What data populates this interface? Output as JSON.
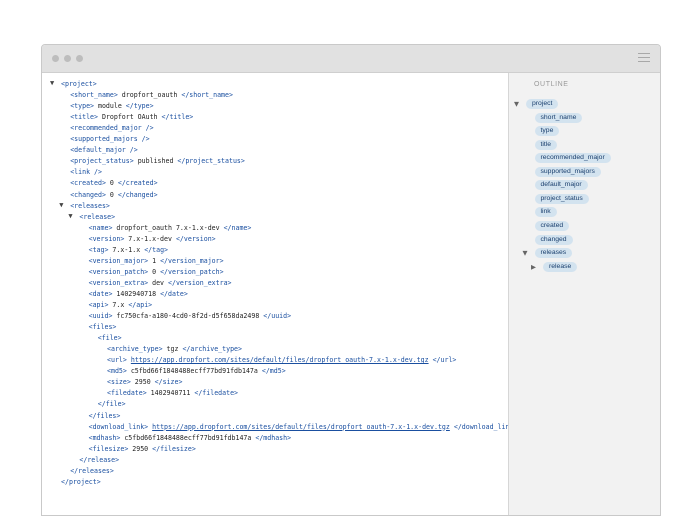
{
  "xml_lines": [
    {
      "indent": 0,
      "toggle": "▼",
      "parts": [
        {
          "t": "tag",
          "v": "<project>"
        }
      ]
    },
    {
      "indent": 1,
      "parts": [
        {
          "t": "tag",
          "v": "<short_name>"
        },
        {
          "t": "text",
          "v": " dropfort_oauth "
        },
        {
          "t": "tag",
          "v": "</short_name>"
        }
      ]
    },
    {
      "indent": 1,
      "parts": [
        {
          "t": "tag",
          "v": "<type>"
        },
        {
          "t": "text",
          "v": " module "
        },
        {
          "t": "tag",
          "v": "</type>"
        }
      ]
    },
    {
      "indent": 1,
      "parts": [
        {
          "t": "tag",
          "v": "<title>"
        },
        {
          "t": "text",
          "v": " Dropfort OAuth "
        },
        {
          "t": "tag",
          "v": "</title>"
        }
      ]
    },
    {
      "indent": 1,
      "parts": [
        {
          "t": "tag",
          "v": "<recommended_major />"
        }
      ]
    },
    {
      "indent": 1,
      "parts": [
        {
          "t": "tag",
          "v": "<supported_majors />"
        }
      ]
    },
    {
      "indent": 1,
      "parts": [
        {
          "t": "tag",
          "v": "<default_major />"
        }
      ]
    },
    {
      "indent": 1,
      "parts": [
        {
          "t": "tag",
          "v": "<project_status>"
        },
        {
          "t": "text",
          "v": " published "
        },
        {
          "t": "tag",
          "v": "</project_status>"
        }
      ]
    },
    {
      "indent": 1,
      "parts": [
        {
          "t": "tag",
          "v": "<link />"
        }
      ]
    },
    {
      "indent": 1,
      "parts": [
        {
          "t": "tag",
          "v": "<created>"
        },
        {
          "t": "text",
          "v": " 0 "
        },
        {
          "t": "tag",
          "v": "</created>"
        }
      ]
    },
    {
      "indent": 1,
      "parts": [
        {
          "t": "tag",
          "v": "<changed>"
        },
        {
          "t": "text",
          "v": " 0 "
        },
        {
          "t": "tag",
          "v": "</changed>"
        }
      ]
    },
    {
      "indent": 1,
      "toggle": "▼",
      "parts": [
        {
          "t": "tag",
          "v": "<releases>"
        }
      ]
    },
    {
      "indent": 2,
      "toggle": "▼",
      "parts": [
        {
          "t": "tag",
          "v": "<release>"
        }
      ]
    },
    {
      "indent": 3,
      "parts": [
        {
          "t": "tag",
          "v": "<name>"
        },
        {
          "t": "text",
          "v": " dropfort_oauth 7.x-1.x-dev "
        },
        {
          "t": "tag",
          "v": "</name>"
        }
      ]
    },
    {
      "indent": 3,
      "parts": [
        {
          "t": "tag",
          "v": "<version>"
        },
        {
          "t": "text",
          "v": " 7.x-1.x-dev "
        },
        {
          "t": "tag",
          "v": "</version>"
        }
      ]
    },
    {
      "indent": 3,
      "parts": [
        {
          "t": "tag",
          "v": "<tag>"
        },
        {
          "t": "text",
          "v": " 7.x-1.x "
        },
        {
          "t": "tag",
          "v": "</tag>"
        }
      ]
    },
    {
      "indent": 3,
      "parts": [
        {
          "t": "tag",
          "v": "<version_major>"
        },
        {
          "t": "text",
          "v": " 1 "
        },
        {
          "t": "tag",
          "v": "</version_major>"
        }
      ]
    },
    {
      "indent": 3,
      "parts": [
        {
          "t": "tag",
          "v": "<version_patch>"
        },
        {
          "t": "text",
          "v": " 0 "
        },
        {
          "t": "tag",
          "v": "</version_patch>"
        }
      ]
    },
    {
      "indent": 3,
      "parts": [
        {
          "t": "tag",
          "v": "<version_extra>"
        },
        {
          "t": "text",
          "v": " dev "
        },
        {
          "t": "tag",
          "v": "</version_extra>"
        }
      ]
    },
    {
      "indent": 3,
      "parts": [
        {
          "t": "tag",
          "v": "<date>"
        },
        {
          "t": "text",
          "v": " 1402940718 "
        },
        {
          "t": "tag",
          "v": "</date>"
        }
      ]
    },
    {
      "indent": 3,
      "parts": [
        {
          "t": "tag",
          "v": "<api>"
        },
        {
          "t": "text",
          "v": " 7.x "
        },
        {
          "t": "tag",
          "v": "</api>"
        }
      ]
    },
    {
      "indent": 3,
      "parts": [
        {
          "t": "tag",
          "v": "<uuid>"
        },
        {
          "t": "text",
          "v": " fc750cfa-a180-4cd0-8f2d-d5f658da2498 "
        },
        {
          "t": "tag",
          "v": "</uuid>"
        }
      ]
    },
    {
      "indent": 3,
      "parts": [
        {
          "t": "tag",
          "v": "<files>"
        }
      ]
    },
    {
      "indent": 4,
      "parts": [
        {
          "t": "tag",
          "v": "<file>"
        }
      ]
    },
    {
      "indent": 5,
      "parts": [
        {
          "t": "tag",
          "v": "<archive_type>"
        },
        {
          "t": "text",
          "v": " tgz "
        },
        {
          "t": "tag",
          "v": "</archive_type>"
        }
      ]
    },
    {
      "indent": 5,
      "parts": [
        {
          "t": "tag",
          "v": "<url>"
        },
        {
          "t": "text",
          "v": " "
        },
        {
          "t": "url",
          "v": "https://app.dropfort.com/sites/default/files/dropfort_oauth-7.x-1.x-dev.tgz"
        },
        {
          "t": "text",
          "v": " "
        },
        {
          "t": "tag",
          "v": "</url>"
        }
      ]
    },
    {
      "indent": 5,
      "parts": [
        {
          "t": "tag",
          "v": "<md5>"
        },
        {
          "t": "text",
          "v": " c5fbd66f1848488ecff77bd91fdb147a "
        },
        {
          "t": "tag",
          "v": "</md5>"
        }
      ]
    },
    {
      "indent": 5,
      "parts": [
        {
          "t": "tag",
          "v": "<size>"
        },
        {
          "t": "text",
          "v": " 2950 "
        },
        {
          "t": "tag",
          "v": "</size>"
        }
      ]
    },
    {
      "indent": 5,
      "parts": [
        {
          "t": "tag",
          "v": "<filedate>"
        },
        {
          "t": "text",
          "v": " 1402940711 "
        },
        {
          "t": "tag",
          "v": "</filedate>"
        }
      ]
    },
    {
      "indent": 4,
      "parts": [
        {
          "t": "tag",
          "v": "</file>"
        }
      ]
    },
    {
      "indent": 3,
      "parts": [
        {
          "t": "tag",
          "v": "</files>"
        }
      ]
    },
    {
      "indent": 3,
      "parts": [
        {
          "t": "tag",
          "v": "<download_link>"
        },
        {
          "t": "text",
          "v": " "
        },
        {
          "t": "url",
          "v": "https://app.dropfort.com/sites/default/files/dropfort_oauth-7.x-1.x-dev.tgz"
        },
        {
          "t": "text",
          "v": " "
        },
        {
          "t": "tag",
          "v": "</download_link>"
        }
      ]
    },
    {
      "indent": 3,
      "parts": [
        {
          "t": "tag",
          "v": "<mdhash>"
        },
        {
          "t": "text",
          "v": " c5fbd66f1848488ecff77bd91fdb147a "
        },
        {
          "t": "tag",
          "v": "</mdhash>"
        }
      ]
    },
    {
      "indent": 3,
      "parts": [
        {
          "t": "tag",
          "v": "<filesize>"
        },
        {
          "t": "text",
          "v": " 2950 "
        },
        {
          "t": "tag",
          "v": "</filesize>"
        }
      ]
    },
    {
      "indent": 2,
      "parts": [
        {
          "t": "tag",
          "v": "</release>"
        }
      ]
    },
    {
      "indent": 1,
      "parts": [
        {
          "t": "tag",
          "v": "</releases>"
        }
      ]
    },
    {
      "indent": 0,
      "parts": [
        {
          "t": "tag",
          "v": "</project>"
        }
      ]
    }
  ],
  "outline": {
    "title": "OUTLINE",
    "items": [
      {
        "label": "project",
        "level": 0,
        "toggle": "▼"
      },
      {
        "label": "short_name",
        "level": 1
      },
      {
        "label": "type",
        "level": 1
      },
      {
        "label": "title",
        "level": 1
      },
      {
        "label": "recommended_major",
        "level": 1
      },
      {
        "label": "supported_majors",
        "level": 1
      },
      {
        "label": "default_major",
        "level": 1
      },
      {
        "label": "project_status",
        "level": 1
      },
      {
        "label": "link",
        "level": 1
      },
      {
        "label": "created",
        "level": 1
      },
      {
        "label": "changed",
        "level": 1
      },
      {
        "label": "releases",
        "level": 1,
        "toggle": "▼"
      },
      {
        "label": "release",
        "level": 2,
        "toggle": "▶"
      }
    ]
  }
}
